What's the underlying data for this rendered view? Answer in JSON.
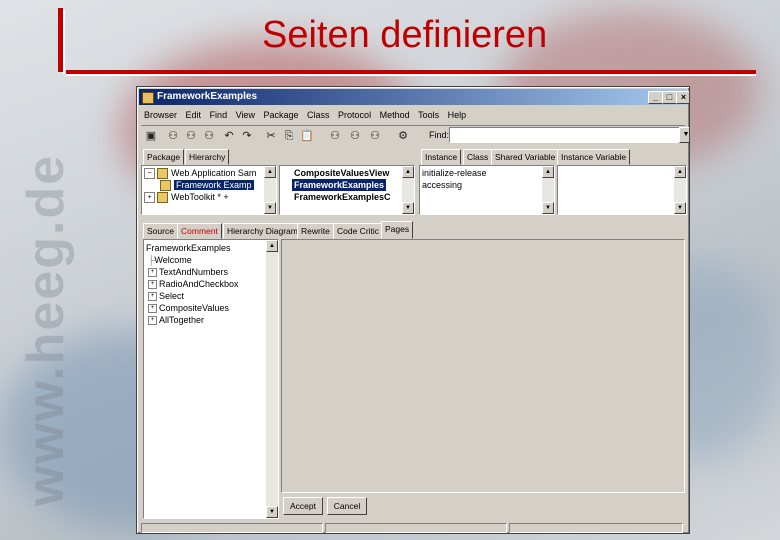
{
  "slide": {
    "title": "Seiten definieren",
    "watermark": "www.heeg.de",
    "accent_color": "#c00000"
  },
  "window": {
    "title": "FrameworkExamples",
    "controls": {
      "minimize": "_",
      "maximize": "□",
      "close": "×"
    }
  },
  "menu": [
    "Browser",
    "Edit",
    "Find",
    "View",
    "Package",
    "Class",
    "Protocol",
    "Method",
    "Tools",
    "Help"
  ],
  "toolbar": {
    "icons": [
      "browser-icon",
      "binoculars-icon",
      "binoculars-icon",
      "binoculars-icon",
      "undo-icon",
      "redo-icon",
      "cut-icon",
      "copy-icon",
      "paste-icon",
      "binoculars-icon",
      "binoculars-icon",
      "binoculars-icon",
      "run-icon"
    ],
    "find_label": "Find:",
    "find_value": ""
  },
  "left_tabs": {
    "package": "Package",
    "hierarchy": "Hierarchy"
  },
  "package_list": [
    "Web Application Sam",
    "Framework Examp",
    "WebToolkit * +"
  ],
  "class_list": [
    "CompositeValuesView",
    "FrameworkExamples",
    "FrameworkExamplesC"
  ],
  "protocol_tabs": {
    "instance": "Instance",
    "class": "Class",
    "shared": "Shared Variable",
    "instvar": "Instance Variable"
  },
  "protocol_list": [
    "initialize-release",
    "accessing"
  ],
  "bottom_tabs": [
    "Source",
    "Comment",
    "Hierarchy Diagram",
    "Rewrite",
    "Code Critic",
    "Pages"
  ],
  "pages_tree": {
    "root": "FrameworkExamples",
    "children": [
      "Welcome",
      "TextAndNumbers",
      "RadioAndCheckbox",
      "Select",
      "CompositeValues",
      "AllTogether"
    ]
  },
  "buttons": {
    "accept": "Accept",
    "cancel": "Cancel"
  }
}
